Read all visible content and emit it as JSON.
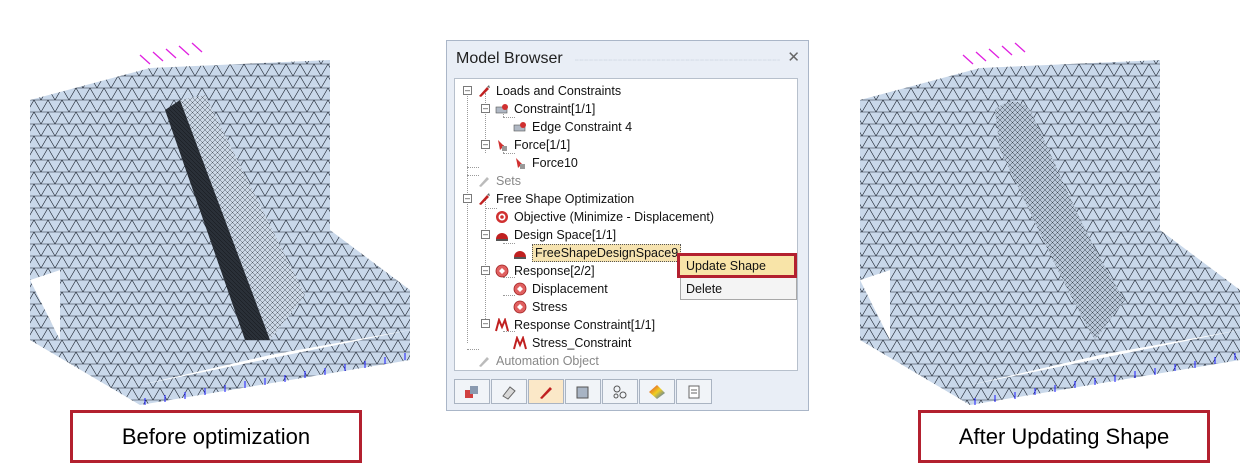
{
  "left_caption": "Before optimization",
  "right_caption": "After Updating Shape",
  "model_browser": {
    "title": "Model Browser",
    "close_glyph": "✕",
    "tree": [
      {
        "label": "Loads and Constraints",
        "icon": "loads-constraints-icon"
      },
      {
        "label": "Constraint[1/1]",
        "icon": "constraint-icon"
      },
      {
        "label": "Edge Constraint 4",
        "icon": "edge-constraint-icon"
      },
      {
        "label": "Force[1/1]",
        "icon": "force-icon"
      },
      {
        "label": "Force10",
        "icon": "force-item-icon"
      },
      {
        "label": "Sets",
        "icon": "sets-icon"
      },
      {
        "label": "Free Shape Optimization",
        "icon": "optimization-icon"
      },
      {
        "label": "Objective  (Minimize - Displacement)",
        "icon": "objective-icon"
      },
      {
        "label": "Design Space[1/1]",
        "icon": "design-space-icon"
      },
      {
        "label": "FreeShapeDesignSpace9",
        "icon": "design-space-item-icon"
      },
      {
        "label": "Response[2/2]",
        "icon": "response-icon"
      },
      {
        "label": "Displacement",
        "icon": "response-item-icon"
      },
      {
        "label": "Stress",
        "icon": "response-item-icon"
      },
      {
        "label": "Response Constraint[1/1]",
        "icon": "response-constraint-icon"
      },
      {
        "label": "Stress_Constraint",
        "icon": "response-constraint-item-icon"
      },
      {
        "label": "Automation Object",
        "icon": "automation-icon"
      }
    ],
    "context_menu": [
      {
        "label": "Update Shape"
      },
      {
        "label": "Delete"
      }
    ],
    "toolbar_icons": [
      "model-icon",
      "eraser-icon",
      "brush-icon",
      "cube-icon",
      "molecule-icon",
      "color-map-icon",
      "script-icon"
    ]
  },
  "colors": {
    "highlight_border": "#b3202f",
    "mesh_fill": "#c9d8ea",
    "mesh_line": "#1c2430",
    "force_arrow": "#e020e0",
    "constraint_arrow": "#1a1aff"
  }
}
